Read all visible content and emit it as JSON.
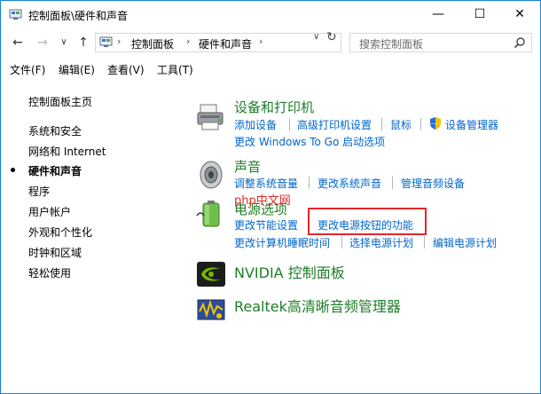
{
  "window": {
    "title": "控制面板\\硬件和声音",
    "minimize_glyph": "—",
    "maximize_glyph": "☐",
    "close_glyph": "✕"
  },
  "nav": {
    "back_glyph": "←",
    "forward_glyph": "→",
    "recent_glyph": "∨",
    "up_glyph": "↑",
    "breadcrumb": [
      "控制面板",
      "硬件和声音"
    ],
    "separator_glyph": "›",
    "dropdown_glyph": "∨",
    "refresh_glyph": "↻",
    "search_placeholder": "搜索控制面板"
  },
  "menu": [
    "文件(F)",
    "编辑(E)",
    "查看(V)",
    "工具(T)"
  ],
  "sidebar": {
    "items": [
      {
        "label": "控制面板主页"
      },
      {
        "label": "系统和安全"
      },
      {
        "label": "网络和 Internet"
      },
      {
        "label": "硬件和声音",
        "current": true
      },
      {
        "label": "程序"
      },
      {
        "label": "用户帐户"
      },
      {
        "label": "外观和个性化"
      },
      {
        "label": "时钟和区域"
      },
      {
        "label": "轻松使用"
      }
    ]
  },
  "categories": {
    "devices": {
      "title": "设备和打印机",
      "icon": "printer-icon",
      "links": [
        "添加设备",
        "高级打印机设置",
        "鼠标",
        "设备管理器",
        "更改 Windows To Go 启动选项"
      ]
    },
    "sound": {
      "title": "声音",
      "icon": "speaker-icon",
      "links": [
        "调整系统音量",
        "更改系统声音",
        "管理音频设备"
      ]
    },
    "power": {
      "title": "电源选项",
      "icon": "battery-icon",
      "links": [
        "更改节能设置",
        "更改电源按钮的功能",
        "更改计算机睡眠时间",
        "选择电源计划",
        "编辑电源计划"
      ]
    },
    "nvidia": {
      "title": "NVIDIA 控制面板",
      "icon": "nvidia-icon"
    },
    "realtek": {
      "title": "Realtek高清晰音频管理器",
      "icon": "realtek-audio-icon"
    }
  },
  "watermark": "php中文网",
  "colors": {
    "category_title": "#1e7d28",
    "link": "#0066cc",
    "highlight_box": "#e3262a",
    "window_border": "#1883d7"
  }
}
